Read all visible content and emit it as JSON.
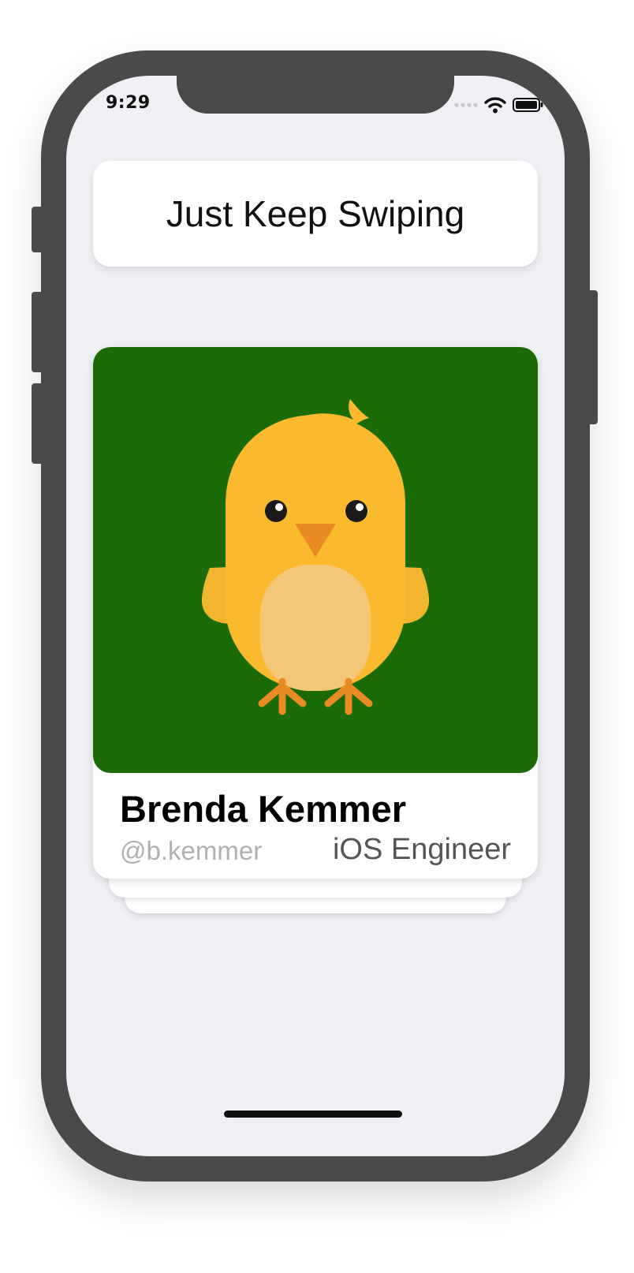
{
  "status_bar": {
    "time": "9:29",
    "icons": [
      "signal-dots-icon",
      "wifi-icon",
      "battery-icon"
    ]
  },
  "header": {
    "title": "Just Keep Swiping"
  },
  "profile_card": {
    "name": "Brenda Kemmer",
    "handle": "@b.kemmer",
    "role": "iOS Engineer",
    "avatar": "chick-avatar",
    "avatar_background": "#1b6b07"
  },
  "stack": {
    "cards_behind": 2
  },
  "colors": {
    "screen_background": "#efeff4",
    "device_frame": "#4a4a4a",
    "chick_body": "#fbb92d",
    "chick_belly": "#f4c678",
    "chick_beak": "#ea8a22",
    "chick_feet": "#ea8a22"
  }
}
